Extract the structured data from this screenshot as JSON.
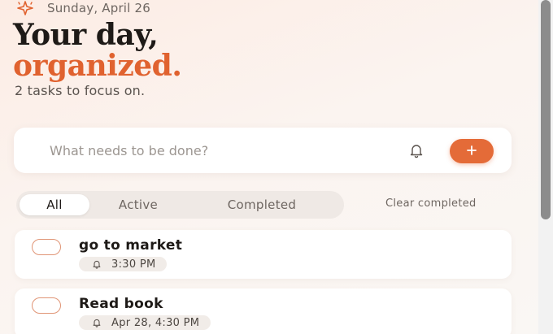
{
  "header": {
    "logo": "sparkle-icon",
    "date": "Sunday, April 26",
    "headline_line1": "Your day,",
    "headline_line2": "organized.",
    "subtitle": "2 tasks to focus on."
  },
  "composer": {
    "placeholder": "What needs to be done?",
    "value": "",
    "reminder_icon": "bell-icon",
    "add_icon": "plus-icon"
  },
  "filters": {
    "tabs": [
      {
        "label": "All",
        "selected": true
      },
      {
        "label": "Active",
        "selected": false
      },
      {
        "label": "Completed",
        "selected": false
      }
    ],
    "clear_label": "Clear completed"
  },
  "tasks": [
    {
      "title": "go to market",
      "reminder": "3:30 PM",
      "done": false
    },
    {
      "title": "Read book",
      "reminder": "Apr 28, 4:30 PM",
      "done": false
    }
  ],
  "colors": {
    "accent": "#e46b38",
    "headline_accent": "#e0622f",
    "text": "#1e1a17",
    "muted": "#6e6661"
  }
}
